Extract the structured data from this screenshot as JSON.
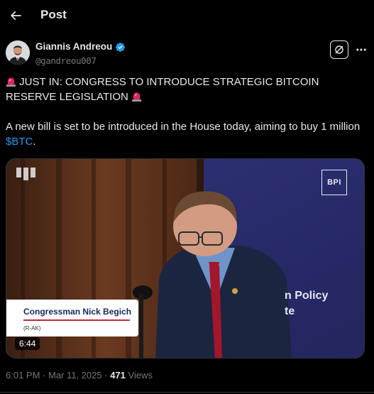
{
  "header": {
    "title": "Post"
  },
  "author": {
    "name": "Giannis Andreou",
    "handle": "@gandreou007"
  },
  "tweet": {
    "line1": "JUST IN: CONGRESS TO INTRODUCE STRATEGIC BITCOIN RESERVE LEGISLATION",
    "line2_prefix": "A new bill is set to be introduced in the House today, aiming to buy 1 million ",
    "cashtag": "$BTC",
    "line2_suffix": "."
  },
  "media": {
    "lower_third_name": "Congressman Nick Begich",
    "lower_third_party": "(R-AK)",
    "logo_text": "BPI",
    "background_text_1": "n Policy",
    "background_text_2": "te",
    "duration": "6:44"
  },
  "meta": {
    "time": "6:01 PM",
    "sep1": " · ",
    "date": "Mar 11, 2025",
    "sep2": " · ",
    "views_count": "471",
    "views_label": " Views"
  },
  "colors": {
    "background": "#000000",
    "text": "#e7e9ea",
    "muted": "#71767b",
    "accent": "#1d9bf0",
    "divider": "#2f3336"
  },
  "icons": [
    "back-arrow-icon",
    "verified-badge-icon",
    "grok-icon",
    "more-icon",
    "siren-icon",
    "video-watermark-icon"
  ]
}
